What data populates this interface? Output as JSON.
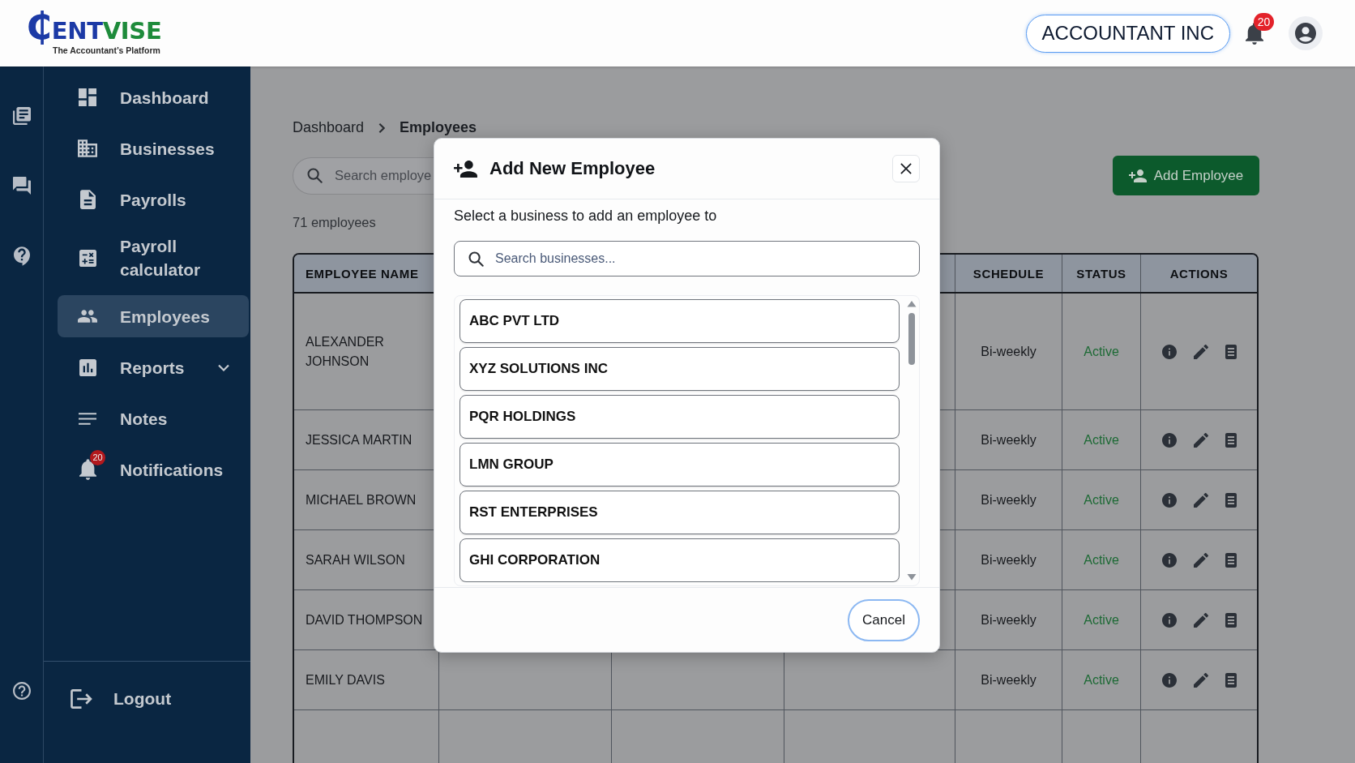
{
  "header": {
    "logo": {
      "wordmark_blue": "₵ENT",
      "wordmark_green": "VISE",
      "tagline": "The Accountant’s Platform"
    },
    "account": "ACCOUNTANT INC",
    "notification_badge": "20"
  },
  "sidebar": {
    "items": [
      {
        "label": "Dashboard",
        "selected": false
      },
      {
        "label": "Businesses",
        "selected": false
      },
      {
        "label": "Payrolls",
        "selected": false
      },
      {
        "label": "Payroll calculator",
        "selected": false
      },
      {
        "label": "Employees",
        "selected": true
      },
      {
        "label": "Reports",
        "selected": false,
        "expanded": false
      },
      {
        "label": "Notes",
        "selected": false
      },
      {
        "label": "Notifications",
        "selected": false,
        "badge": "20"
      }
    ],
    "logout": "Logout"
  },
  "breadcrumb": [
    {
      "label": "Dashboard",
      "current": false
    },
    {
      "label": "Employees",
      "current": true
    }
  ],
  "search": {
    "placeholder": "Search employe"
  },
  "add_button": "Add Employee",
  "employee_count": "71 employees",
  "table": {
    "columns": [
      "EMPLOYEE NAME",
      "SCHEDULE",
      "STATUS",
      "ACTIONS"
    ],
    "rows": [
      {
        "name": "ALEXANDER JOHNSON",
        "schedule": "Bi-weekly",
        "status": "Active"
      },
      {
        "name": "JESSICA MARTIN",
        "schedule": "Bi-weekly",
        "status": "Active"
      },
      {
        "name": "MICHAEL BROWN",
        "schedule": "Bi-weekly",
        "status": "Active"
      },
      {
        "name": "SARAH WILSON",
        "schedule": "Bi-weekly",
        "status": "Active"
      },
      {
        "name": "DAVID THOMPSON",
        "schedule": "Bi-weekly",
        "status": "Active"
      },
      {
        "name": "EMILY DAVIS",
        "schedule": "Bi-weekly",
        "status": "Active"
      }
    ]
  },
  "modal": {
    "title": "Add New Employee",
    "subtitle": "Select a business to add an employee to",
    "search": {
      "placeholder": "Search businesses..."
    },
    "businesses": [
      {
        "name": "ABC PVT LTD",
        "selected": false
      },
      {
        "name": "XYZ SOLUTIONS INC",
        "selected": false
      },
      {
        "name": "PQR HOLDINGS",
        "selected": false
      },
      {
        "name": "LMN GROUP",
        "selected": false
      },
      {
        "name": "RST ENTERPRISES",
        "selected": false
      },
      {
        "name": "GHI CORPORATION",
        "selected": false
      }
    ],
    "cancel": "Cancel"
  }
}
